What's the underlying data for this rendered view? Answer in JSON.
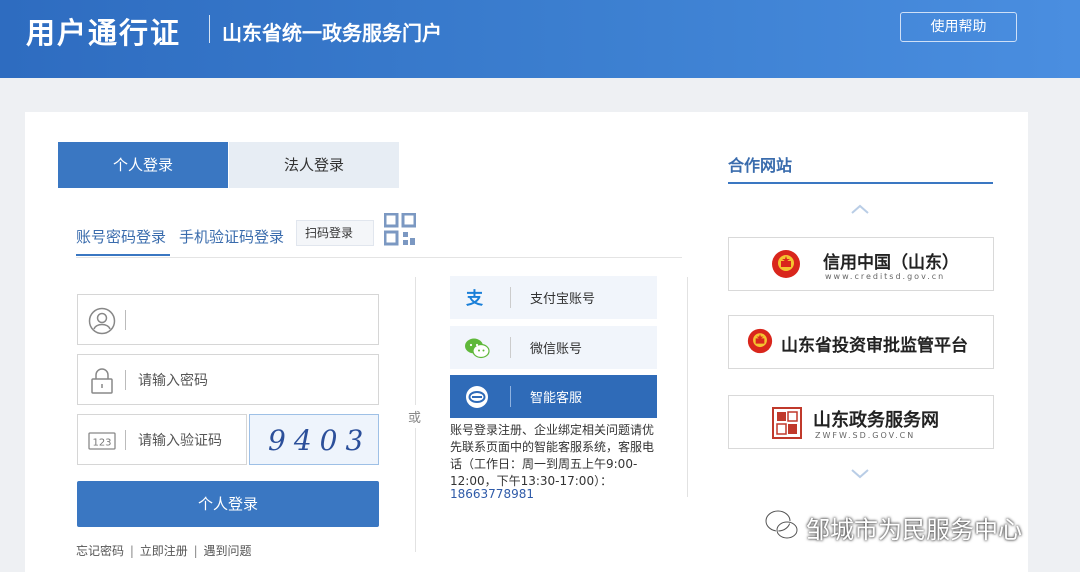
{
  "header": {
    "brand": "用户通行证",
    "subtitle": "山东省统一政务服务门户",
    "help_label": "使用帮助"
  },
  "tabs": [
    "个人登录",
    "法人登录"
  ],
  "login_methods": {
    "account": "账号密码登录",
    "mobile": "手机验证码登录",
    "scan": "扫码登录"
  },
  "form": {
    "username_placeholder": "",
    "password_placeholder": "请输入密码",
    "captcha_placeholder": "请输入验证码",
    "captcha_value": "9403",
    "submit_label": "个人登录"
  },
  "links": [
    "忘记密码",
    "立即注册",
    "遇到问题"
  ],
  "link_sep": "|",
  "or_text": "或",
  "alt_logins": [
    {
      "label": "支付宝账号",
      "icon": "alipay-icon"
    },
    {
      "label": "微信账号",
      "icon": "wechat-icon"
    },
    {
      "label": "智能客服",
      "icon": "customer-service-icon"
    }
  ],
  "service_note": "账号登录注册、企业绑定相关问题请优先联系页面中的智能客服系统，客服电话（工作日：周一到周五上午9:00-12:00，下午13:30-17:00）：",
  "service_phone": "18663778981",
  "partners": {
    "title": "合作网站",
    "items": [
      {
        "name": "信用中国（山东）",
        "sub": "www.creditsd.gov.cn"
      },
      {
        "name": "山东省投资审批监管平台",
        "sub": ""
      },
      {
        "name": "山东政务服务网",
        "sub": "ZWFW.SD.GOV.CN"
      }
    ]
  },
  "watermark": "邹城市为民服务中心",
  "colors": {
    "header_blue": "#3b7dd0",
    "primary": "#3a77c2",
    "link": "#3a6cad"
  }
}
